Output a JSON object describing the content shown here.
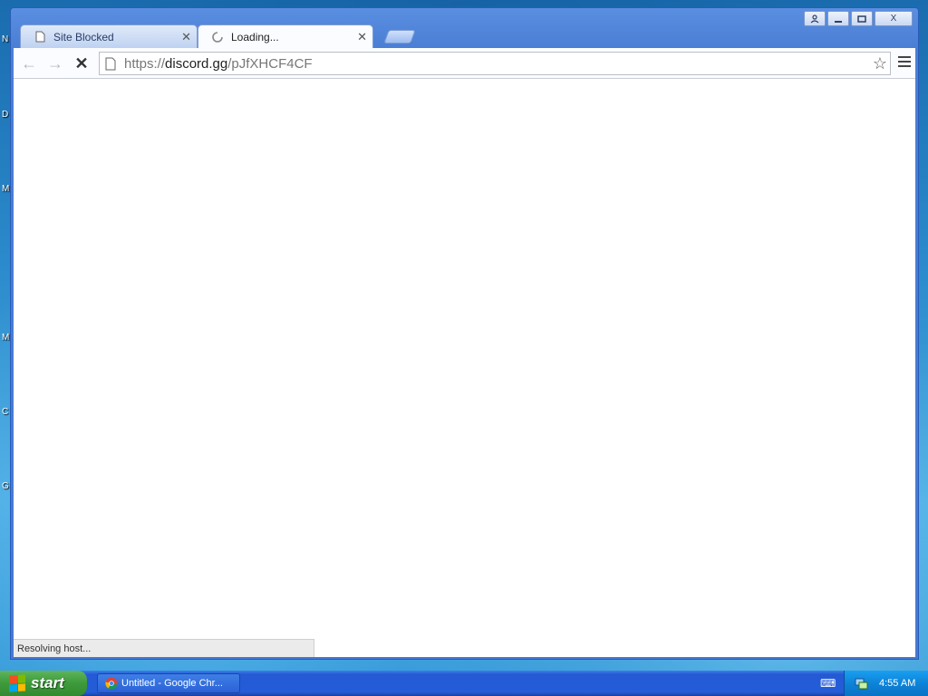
{
  "desktop": {
    "letters": [
      "N",
      "D",
      "M",
      "M",
      "C",
      "G"
    ]
  },
  "window": {
    "controls": {
      "close": "X"
    }
  },
  "tabs": [
    {
      "title": "Site Blocked",
      "active": false
    },
    {
      "title": "Loading...",
      "active": true
    }
  ],
  "toolbar": {
    "url_scheme": "https://",
    "url_host": "discord.gg",
    "url_path": "/pJfXHCF4CF"
  },
  "content": {
    "status": "Resolving host..."
  },
  "taskbar": {
    "start_label": "start",
    "task_items": [
      {
        "label": "Untitled - Google Chr..."
      }
    ],
    "clock": "4:55 AM"
  },
  "colors": {
    "window_frame": "#4679d2",
    "taskbar": "#245dd8",
    "start_button": "#3d9a3a",
    "tray": "#0d83d8"
  }
}
